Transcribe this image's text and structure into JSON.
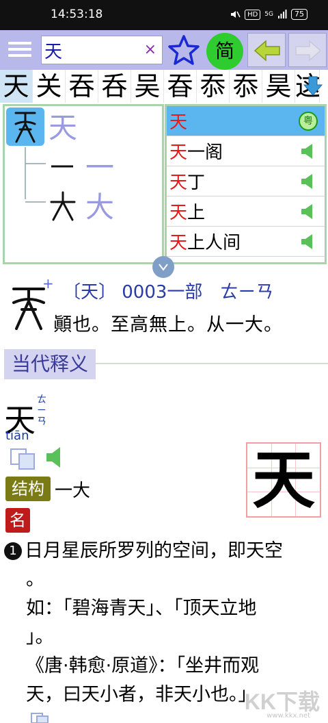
{
  "status": {
    "time": "14:53:18",
    "hd": "HD",
    "signal": "5G",
    "battery": "75"
  },
  "search": {
    "value": "天",
    "clear": "×",
    "simplified_label": "简"
  },
  "char_strip": [
    "天",
    "关",
    "吞",
    "呑",
    "吴",
    "昋",
    "忝",
    "忝",
    "昊",
    "这"
  ],
  "tree": {
    "root_modern": "天",
    "children": [
      {
        "modern": "一"
      },
      {
        "modern": "大"
      }
    ]
  },
  "words": [
    {
      "head": "天",
      "rest": "",
      "badge": "粤"
    },
    {
      "head": "天",
      "rest": "一阁"
    },
    {
      "head": "天",
      "rest": "丁"
    },
    {
      "head": "天",
      "rest": "上"
    },
    {
      "head": "天",
      "rest": "上人间"
    }
  ],
  "entry": {
    "line": "〔天〕 0003一部　ㄊㄧㄢ",
    "shuowen": "顚也。至高無上。从一大。",
    "plus": "+"
  },
  "section": {
    "title": "当代释义"
  },
  "headword": {
    "char": "天",
    "zhuyin": "ㄊㄧㄢ",
    "pinyin": "tiān",
    "grid_char": "天"
  },
  "structure": {
    "label": "结构",
    "value": "一大"
  },
  "pos": {
    "label": "名"
  },
  "definition": {
    "number": "1",
    "line1": "日月星辰所罗列的空间，即天空",
    "line2": "。",
    "line3": "如：「碧海青天」、「顶天立地",
    "line4": "」。",
    "line5": "《唐·韩愈·原道》：「坐井而观",
    "line6": "天，曰天小者，非天小也。」"
  },
  "watermark": {
    "main": "KK下载",
    "sub": "www.kkx.net"
  }
}
